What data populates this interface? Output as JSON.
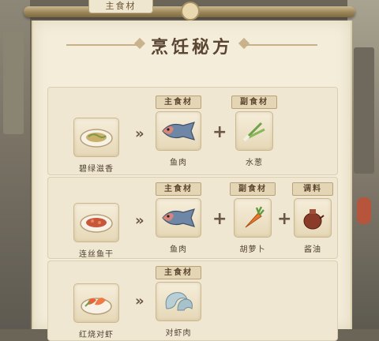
{
  "header": {
    "tab_label": "主食材",
    "title": "烹饪秘方"
  },
  "recipes": [
    {
      "dish": {
        "name": "碧绿滋香",
        "icon": "plate-icon"
      },
      "main_tag": "主食材",
      "main": {
        "name": "鱼肉",
        "icon": "fish-icon"
      },
      "side_tag": "副食材",
      "side": {
        "name": "水葱",
        "icon": "scallion-icon"
      }
    },
    {
      "dish": {
        "name": "连丝鱼干",
        "icon": "dried-fish-plate-icon"
      },
      "main_tag": "主食材",
      "main": {
        "name": "鱼肉",
        "icon": "fish-icon"
      },
      "side_tag": "副食材",
      "side": {
        "name": "胡萝卜",
        "icon": "carrot-icon"
      },
      "seasoning_tag": "调料",
      "seasoning": {
        "name": "酱油",
        "icon": "soy-sauce-pot-icon"
      }
    },
    {
      "dish": {
        "name": "红烧对虾",
        "icon": "shrimp-bowl-icon"
      },
      "main_tag": "主食材",
      "main": {
        "name": "对虾肉",
        "icon": "shrimp-meat-icon"
      }
    }
  ],
  "symbols": {
    "arrow": "»",
    "plus": "+"
  },
  "colors": {
    "paper": "#f3edda",
    "rod": "#9a8558",
    "text": "#4e3e2e"
  }
}
